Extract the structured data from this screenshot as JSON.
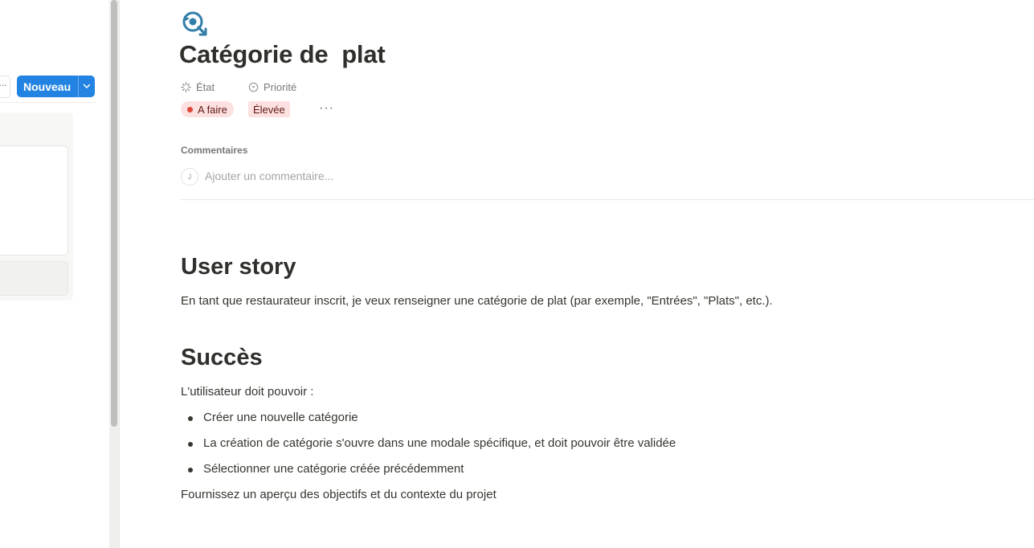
{
  "board": {
    "more_label": "···",
    "new_button_label": "Nouveau"
  },
  "page": {
    "icon": "refresh-search-icon",
    "title": "Catégorie de  plat",
    "properties": {
      "state_label": "État",
      "priority_label": "Priorité",
      "state_value": "A faire",
      "priority_value": "Élevée",
      "more_label": "···"
    },
    "comments": {
      "heading": "Commentaires",
      "avatar_initial": "J",
      "placeholder": "Ajouter un commentaire..."
    },
    "content": {
      "user_story_heading": "User story",
      "user_story_text": "En tant que restaurateur inscrit, je veux renseigner une catégorie de plat (par exemple, \"Entrées\", \"Plats\", etc.).",
      "success_heading": "Succès",
      "success_intro": "L'utilisateur doit pouvoir :",
      "success_items": [
        "Créer une nouvelle catégorie",
        "La création de catégorie s'ouvre dans une modale spécifique, et doit pouvoir être validée",
        "Sélectionner une catégorie créée précédemment"
      ],
      "footer_text": "Fournissez un aperçu des objectifs et du contexte du projet"
    }
  },
  "colors": {
    "accent": "#2383e2",
    "icon_blue": "#337ea9",
    "state_dot": "#e0453a",
    "badge_bg": "#fde0e0"
  }
}
